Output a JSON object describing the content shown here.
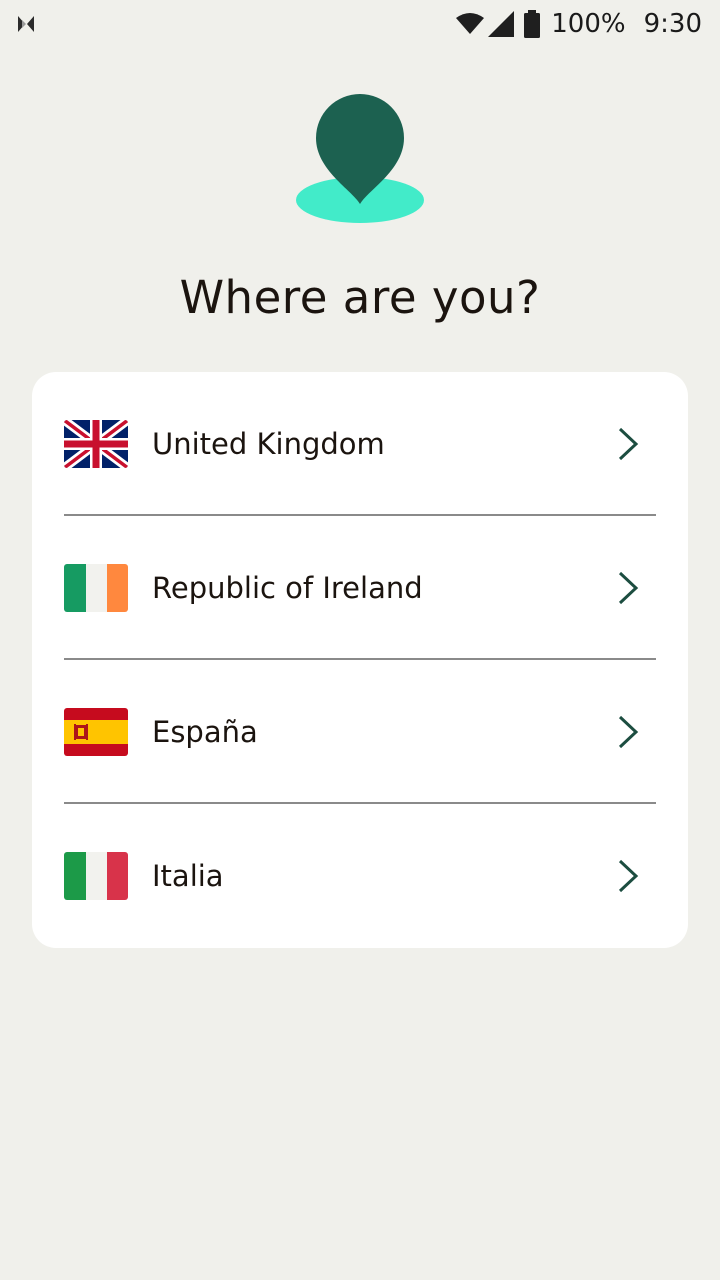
{
  "status_bar": {
    "left_icon": "app-notification-icon",
    "wifi_icon": "wifi-icon",
    "signal_icon": "cell-signal-icon",
    "battery_icon": "battery-icon",
    "battery_percent": "100%",
    "time": "9:30"
  },
  "hero": {
    "icon": "location-pin-icon",
    "pin_color": "#1c6150",
    "shadow_color": "#42ebc9"
  },
  "title": "Where are you?",
  "countries": [
    {
      "label": "United Kingdom",
      "flag": "uk-flag-icon"
    },
    {
      "label": "Republic of Ireland",
      "flag": "ireland-flag-icon"
    },
    {
      "label": "España",
      "flag": "spain-flag-icon"
    },
    {
      "label": "Italia",
      "flag": "italy-flag-icon"
    }
  ],
  "chevron_icon": "chevron-right-icon",
  "colors": {
    "background": "#f0f0eb",
    "card": "#ffffff",
    "chevron": "#1c4d40",
    "text": "#1b140f"
  }
}
